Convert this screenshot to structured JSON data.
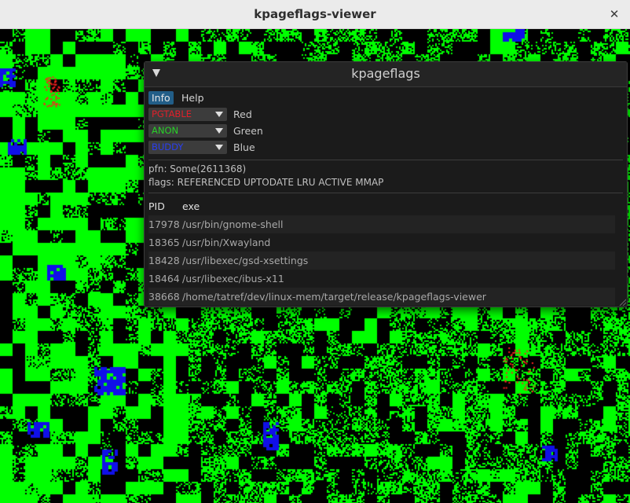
{
  "window": {
    "title": "kpageflags-viewer"
  },
  "panel": {
    "title": "kpageflags",
    "menu": [
      "Info",
      "Help"
    ],
    "selectors": [
      {
        "value": "PGTABLE",
        "channel": "Red",
        "color": "#e0202a"
      },
      {
        "value": "ANON",
        "channel": "Green",
        "color": "#28d028"
      },
      {
        "value": "BUDDY",
        "channel": "Blue",
        "color": "#2a3ef0"
      }
    ],
    "pfn_text": "pfn: Some(2611368)",
    "flags_text": "flags: REFERENCED UPTODATE LRU ACTIVE MMAP",
    "table": {
      "headers": {
        "pid": "PID",
        "exe": "exe"
      },
      "rows": [
        {
          "pid": "17978",
          "exe": "/usr/bin/gnome-shell"
        },
        {
          "pid": "18365",
          "exe": "/usr/bin/Xwayland"
        },
        {
          "pid": "18428",
          "exe": "/usr/libexec/gsd-xsettings"
        },
        {
          "pid": "18464",
          "exe": "/usr/libexec/ibus-x11"
        },
        {
          "pid": "38668",
          "exe": "/home/tatref/dev/linux-mem/target/release/kpageflags-viewer"
        }
      ]
    }
  },
  "colors": {
    "green": "#00ff00",
    "blue": "#1010e8",
    "red": "#ff2020",
    "background": "#000000"
  }
}
